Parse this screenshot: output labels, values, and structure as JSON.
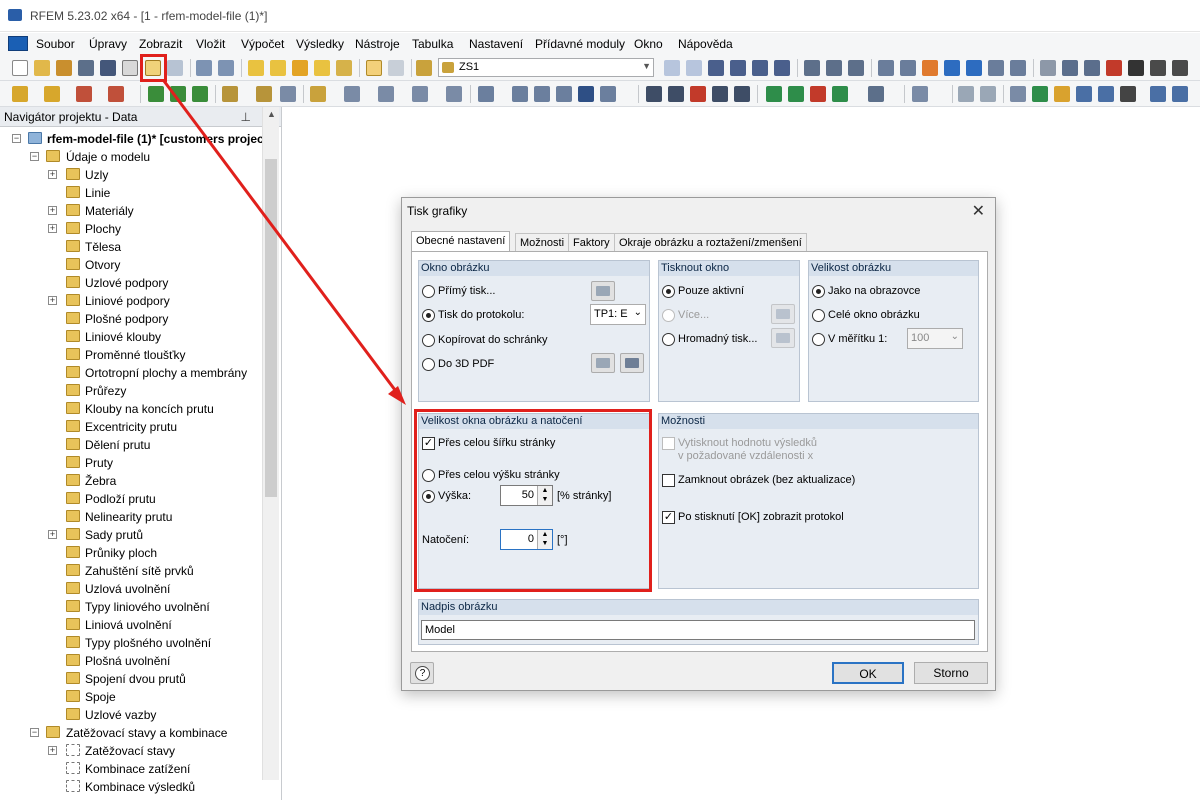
{
  "window": {
    "title": "RFEM 5.23.02 x64 - [1 - rfem-model-file (1)*]"
  },
  "menu": {
    "items": [
      "Soubor",
      "Úpravy",
      "Zobrazit",
      "Vložit",
      "Výpočet",
      "Výsledky",
      "Nástroje",
      "Tabulka",
      "Nastavení",
      "Přídavné moduly",
      "Okno",
      "Nápověda"
    ]
  },
  "toolbar": {
    "load_case": "ZS1"
  },
  "navigator": {
    "title": "Navigátor projektu - Data",
    "root": "rfem-model-file (1)* [customers projec",
    "model_data": "Údaje o modelu",
    "items": [
      "Uzly",
      "Linie",
      "Materiály",
      "Plochy",
      "Tělesa",
      "Otvory",
      "Uzlové podpory",
      "Liniové podpory",
      "Plošné podpory",
      "Liniové klouby",
      "Proměnné tloušťky",
      "Ortotropní plochy a membrány",
      "Průřezy",
      "Klouby na koncích prutu",
      "Excentricity prutu",
      "Dělení prutu",
      "Pruty",
      "Žebra",
      "Podloží prutu",
      "Nelinearity prutu",
      "Sady prutů",
      "Průniky ploch",
      "Zahuštění sítě prvků",
      "Uzlová uvolnění",
      "Typy liniového uvolnění",
      "Liniová uvolnění",
      "Typy plošného uvolnění",
      "Plošná uvolnění",
      "Spojení dvou prutů",
      "Spoje",
      "Uzlové vazby"
    ],
    "load_group": "Zatěžovací stavy a kombinace",
    "load_items": [
      "Zatěžovací stavy",
      "Kombinace zatížení",
      "Kombinace výsledků"
    ]
  },
  "dialog": {
    "title": "Tisk grafiky",
    "tabs": [
      "Obecné nastavení",
      "Možnosti",
      "Faktory",
      "Okraje obrázku a roztažení/zmenšení"
    ],
    "window_group": {
      "title": "Okno obrázku",
      "direct_print": "Přímý tisk...",
      "to_protocol": "Tisk do protokolu:",
      "protocol_value": "TP1: E",
      "clipboard": "Kopírovat do schránky",
      "to_3dpdf": "Do 3D PDF"
    },
    "print_window_group": {
      "title": "Tisknout okno",
      "only_active": "Pouze aktivní",
      "more": "Více...",
      "batch": "Hromadný tisk..."
    },
    "size_group": {
      "title": "Velikost obrázku",
      "as_screen": "Jako na obrazovce",
      "whole_window": "Celé okno obrázku",
      "scale": "V měřítku 1:",
      "scale_value": "100"
    },
    "window_size_group": {
      "title": "Velikost okna obrázku a natočení",
      "full_width": "Přes celou šířku stránky",
      "full_height": "Přes celou výšku stránky",
      "height_label": "Výška:",
      "height_value": "50",
      "height_unit": "[% stránky]",
      "rotation_label": "Natočení:",
      "rotation_value": "0",
      "rotation_unit": "[°]"
    },
    "options_group": {
      "title": "Možnosti",
      "print_value_l1": "Vytisknout hodnotu výsledků",
      "print_value_l2": "v požadované vzdálenosti x",
      "lock_image": "Zamknout obrázek (bez aktualizace)",
      "show_protocol": "Po stisknutí [OK] zobrazit protokol"
    },
    "caption_group": {
      "title": "Nadpis obrázku",
      "value": "Model"
    },
    "ok": "OK",
    "cancel": "Storno"
  }
}
